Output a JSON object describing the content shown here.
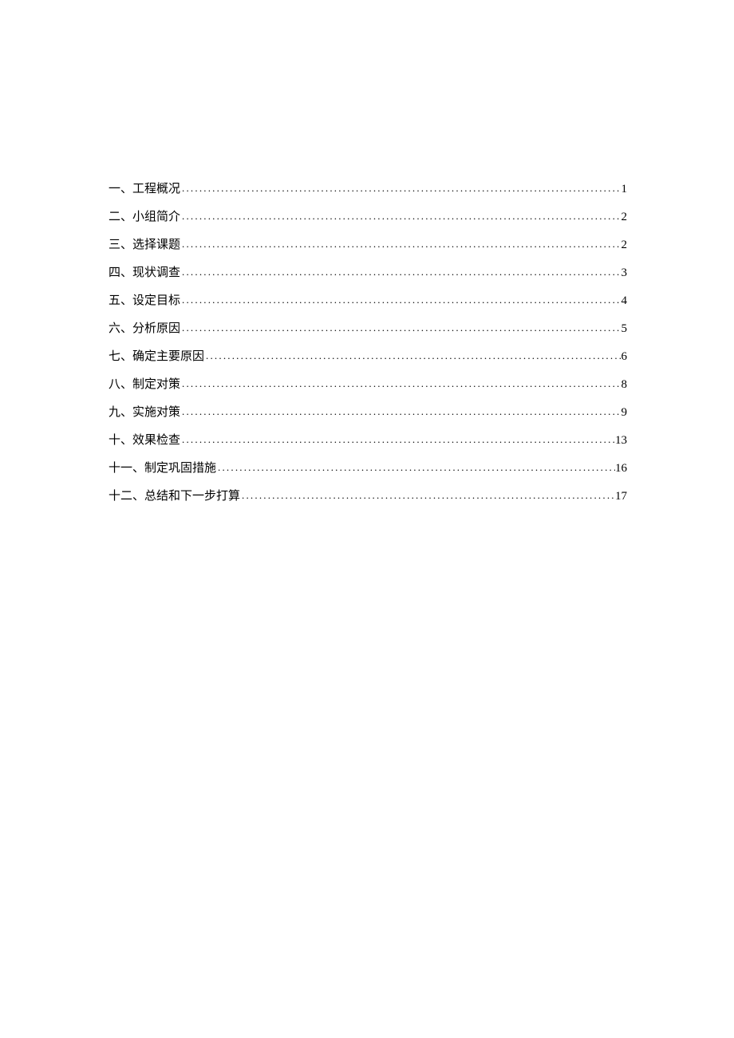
{
  "toc": {
    "entries": [
      {
        "label": "一、工程概况",
        "page": "1"
      },
      {
        "label": "二、小组简介",
        "page": "2"
      },
      {
        "label": "三、选择课题",
        "page": "2"
      },
      {
        "label": "四、现状调查",
        "page": "3"
      },
      {
        "label": "五、设定目标",
        "page": "4"
      },
      {
        "label": "六、分析原因",
        "page": "5"
      },
      {
        "label": "七、确定主要原因",
        "page": "6"
      },
      {
        "label": "八、制定对策",
        "page": "8"
      },
      {
        "label": "九、实施对策",
        "page": "9"
      },
      {
        "label": "十、效果检查",
        "page": "13"
      },
      {
        "label": "十一、制定巩固措施",
        "page": "16"
      },
      {
        "label": "十二、总结和下一步打算",
        "page": "17"
      }
    ]
  }
}
